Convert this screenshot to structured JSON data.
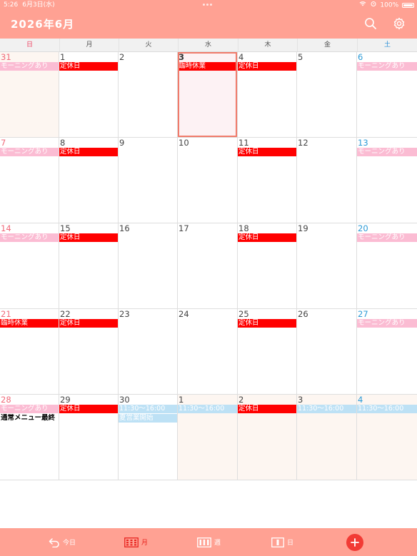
{
  "status": {
    "time": "5:26",
    "date": "6月3日(水)",
    "battery_text": "100%"
  },
  "header": {
    "title": "2026年6月",
    "search_icon": "search-icon",
    "settings_icon": "gear-icon"
  },
  "weekdays": [
    "日",
    "月",
    "火",
    "水",
    "木",
    "金",
    "土"
  ],
  "weeks": [
    [
      {
        "day": "31",
        "other": true,
        "events": [
          {
            "text": "モーニングあり",
            "color": "pink"
          }
        ]
      },
      {
        "day": "1",
        "events": [
          {
            "text": "定休日",
            "color": "red"
          }
        ]
      },
      {
        "day": "2",
        "events": []
      },
      {
        "day": "3",
        "today": true,
        "events": [
          {
            "text": "臨時休業",
            "color": "red"
          }
        ]
      },
      {
        "day": "4",
        "events": [
          {
            "text": "定休日",
            "color": "red"
          }
        ]
      },
      {
        "day": "5",
        "events": []
      },
      {
        "day": "6",
        "events": [
          {
            "text": "モーニングあり",
            "color": "pink"
          }
        ]
      }
    ],
    [
      {
        "day": "7",
        "events": [
          {
            "text": "モーニングあり",
            "color": "pink"
          }
        ]
      },
      {
        "day": "8",
        "events": [
          {
            "text": "定休日",
            "color": "red"
          }
        ]
      },
      {
        "day": "9",
        "events": []
      },
      {
        "day": "10",
        "events": []
      },
      {
        "day": "11",
        "events": [
          {
            "text": "定休日",
            "color": "red"
          }
        ]
      },
      {
        "day": "12",
        "events": []
      },
      {
        "day": "13",
        "events": [
          {
            "text": "モーニングあり",
            "color": "pink"
          }
        ]
      }
    ],
    [
      {
        "day": "14",
        "events": [
          {
            "text": "モーニングあり",
            "color": "pink"
          }
        ]
      },
      {
        "day": "15",
        "events": [
          {
            "text": "定休日",
            "color": "red"
          }
        ]
      },
      {
        "day": "16",
        "events": []
      },
      {
        "day": "17",
        "events": []
      },
      {
        "day": "18",
        "events": [
          {
            "text": "定休日",
            "color": "red"
          }
        ]
      },
      {
        "day": "19",
        "events": []
      },
      {
        "day": "20",
        "events": [
          {
            "text": "モーニングあり",
            "color": "pink"
          }
        ]
      }
    ],
    [
      {
        "day": "21",
        "events": [
          {
            "text": "臨時休業",
            "color": "red"
          }
        ]
      },
      {
        "day": "22",
        "events": [
          {
            "text": "定休日",
            "color": "red"
          }
        ]
      },
      {
        "day": "23",
        "events": []
      },
      {
        "day": "24",
        "events": []
      },
      {
        "day": "25",
        "events": [
          {
            "text": "定休日",
            "color": "red"
          }
        ]
      },
      {
        "day": "26",
        "events": []
      },
      {
        "day": "27",
        "events": [
          {
            "text": "モーニングあり",
            "color": "pink"
          }
        ]
      }
    ],
    [
      {
        "day": "28",
        "events": [
          {
            "text": "モーニングあり",
            "color": "pink"
          },
          {
            "text": "通常メニュー最終",
            "color": "plain"
          }
        ]
      },
      {
        "day": "29",
        "events": [
          {
            "text": "定休日",
            "color": "red"
          }
        ]
      },
      {
        "day": "30",
        "events": [
          {
            "text": "11:30〜16:00",
            "color": "blue"
          },
          {
            "text": "夏営業開始",
            "color": "blue"
          }
        ]
      },
      {
        "day": "1",
        "other": true,
        "events": [
          {
            "text": "11:30〜16:00",
            "color": "blue"
          }
        ]
      },
      {
        "day": "2",
        "other": true,
        "events": [
          {
            "text": "定休日",
            "color": "red"
          }
        ]
      },
      {
        "day": "3",
        "other": true,
        "events": [
          {
            "text": "11:30〜16:00",
            "color": "blue"
          }
        ]
      },
      {
        "day": "4",
        "other": true,
        "events": [
          {
            "text": "11:30〜16:00",
            "color": "blue"
          }
        ]
      }
    ]
  ],
  "toolbar": {
    "today_label": "今日",
    "month_label": "月",
    "week_label": "週",
    "day_label": "日",
    "add_icon": "plus-icon"
  },
  "colors": {
    "accent": "#ffa193",
    "event_red": "#ff0000",
    "event_pink": "#fbbcd3",
    "event_blue": "#bde1f5",
    "today_border": "#f07a6a",
    "add_button": "#f23b35"
  }
}
